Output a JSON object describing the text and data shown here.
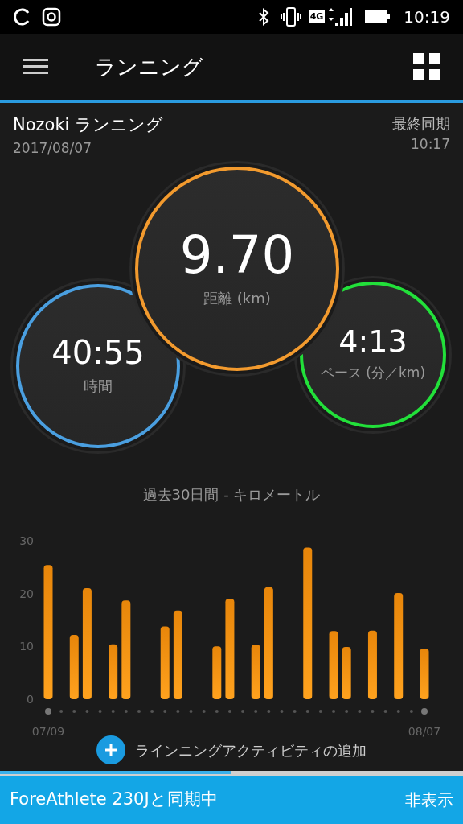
{
  "status_bar": {
    "network": "4G",
    "time": "10:19"
  },
  "app_bar": {
    "title": "ランニング"
  },
  "header": {
    "title": "Nozoki ランニング",
    "date": "2017/08/07",
    "sync_label": "最終同期",
    "sync_time": "10:17"
  },
  "metrics": [
    {
      "value": "9.70",
      "label": "距離 (km)",
      "color": "#f29a2e"
    },
    {
      "value": "40:55",
      "label": "時間",
      "color": "#4a9fe0"
    },
    {
      "value": "4:13",
      "label": "ペース (分／km)",
      "color": "#22e03a"
    }
  ],
  "chart": {
    "title": "過去30日間 - キロメートル",
    "chart_data": {
      "type": "bar",
      "categories": [
        "07/09",
        null,
        null,
        null,
        null,
        null,
        null,
        null,
        null,
        null,
        null,
        null,
        null,
        null,
        null,
        null,
        null,
        null,
        null,
        null,
        null,
        null,
        null,
        null,
        null,
        null,
        null,
        null,
        null,
        "08/07"
      ],
      "values": [
        25.4,
        null,
        12.2,
        21.0,
        null,
        10.4,
        18.7,
        null,
        null,
        13.8,
        16.8,
        null,
        null,
        10.0,
        19.0,
        null,
        10.3,
        21.2,
        null,
        null,
        28.7,
        null,
        12.9,
        9.9,
        null,
        13.0,
        null,
        20.1,
        null,
        9.6
      ],
      "ylim": [
        0,
        30
      ],
      "yticks": [
        0,
        10,
        20,
        30
      ]
    }
  },
  "add_activity": {
    "label": "ラインニングアクティビティの追加"
  },
  "sync_banner": {
    "message": "ForeAthlete 230Jと同期中",
    "action": "非表示",
    "level": 0.5
  }
}
